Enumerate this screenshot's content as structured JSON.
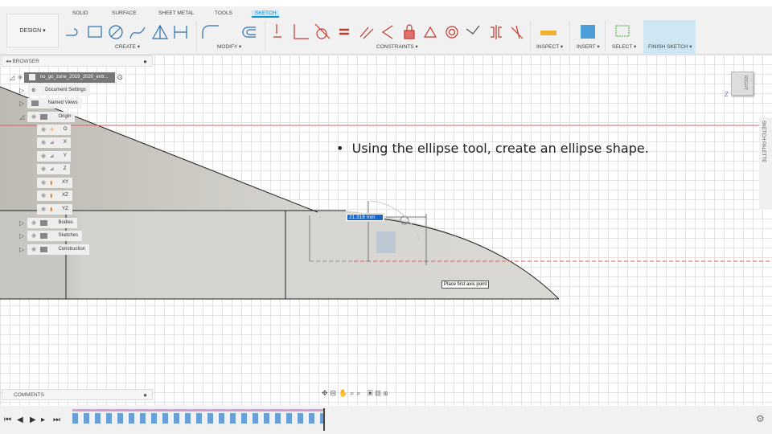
{
  "toolbar": {
    "workspace": "DESIGN ▾",
    "tabs": [
      "SOLID",
      "SURFACE",
      "SHEET METAL",
      "TOOLS",
      "SKETCH"
    ],
    "groups": {
      "create": "CREATE ▾",
      "modify": "MODIFY ▾",
      "constraints": "CONSTRAINTS ▾",
      "inspect": "INSPECT ▾",
      "insert": "INSERT ▾",
      "select": "SELECT ▾",
      "finish": "FINISH SKETCH ▾"
    }
  },
  "browser": {
    "title": "BROWSER",
    "root": "no_go_zone_2019_2020_entr...",
    "items": [
      "Document Settings",
      "Named Views",
      "Origin",
      "O",
      "X",
      "Y",
      "Z",
      "XY",
      "XZ",
      "YZ",
      "Bodies",
      "Sketches",
      "Construction"
    ]
  },
  "comments": {
    "title": "COMMENTS"
  },
  "sketch": {
    "dimension": "21.318 mm",
    "tooltip": "Place first axis point"
  },
  "viewcube": {
    "face": "RIGHT",
    "z": "Z"
  },
  "palette": {
    "title": "SKETCH PALETTE"
  },
  "note": "Using the ellipse tool, create an ellipse shape.",
  "colors": {
    "accent": "#0696d7",
    "finish": "#3aaa35",
    "constraint": "#c0392b"
  }
}
